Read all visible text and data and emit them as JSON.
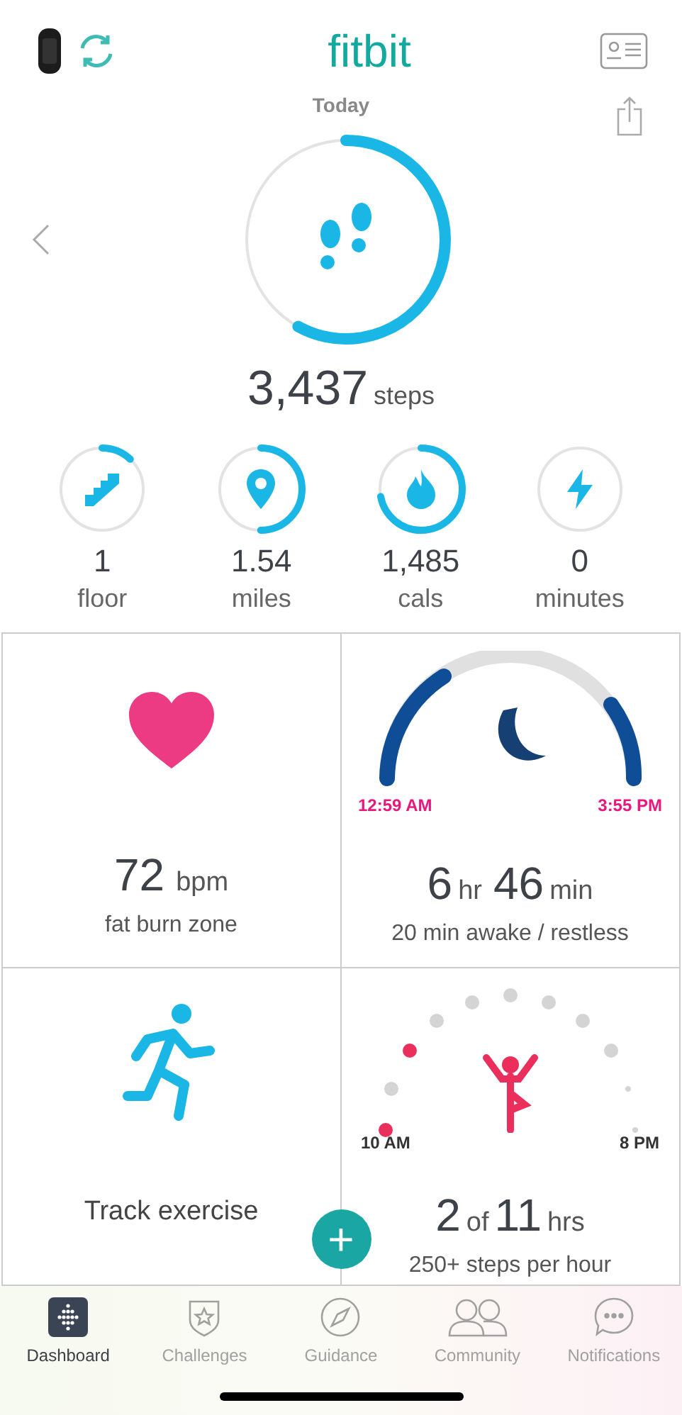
{
  "header": {
    "title": "fitbit",
    "subtitle": "Today"
  },
  "steps": {
    "value": "3,437",
    "unit": "steps"
  },
  "stats": [
    {
      "kind": "floors",
      "value": "1",
      "unit": "floor"
    },
    {
      "kind": "distance",
      "value": "1.54",
      "unit": "miles"
    },
    {
      "kind": "calories",
      "value": "1,485",
      "unit": "cals"
    },
    {
      "kind": "active",
      "value": "0",
      "unit": "minutes"
    }
  ],
  "heart": {
    "value": "72",
    "unit": "bpm",
    "caption": "fat burn zone"
  },
  "sleep": {
    "start": "12:59 AM",
    "end": "3:55 PM",
    "hours": "6",
    "hours_unit": "hr",
    "minutes": "46",
    "minutes_unit": "min",
    "caption": "20 min awake / restless"
  },
  "exercise": {
    "label": "Track exercise",
    "add_button": "+"
  },
  "hourly": {
    "start": "10 AM",
    "end": "8 PM",
    "value": "2",
    "of": "of",
    "total": "11",
    "unit": "hrs",
    "caption": "250+ steps per hour"
  },
  "tabs": [
    {
      "label": "Dashboard",
      "selected": true
    },
    {
      "label": "Challenges",
      "selected": false
    },
    {
      "label": "Guidance",
      "selected": false
    },
    {
      "label": "Community",
      "selected": false
    },
    {
      "label": "Notifications",
      "selected": false
    }
  ]
}
